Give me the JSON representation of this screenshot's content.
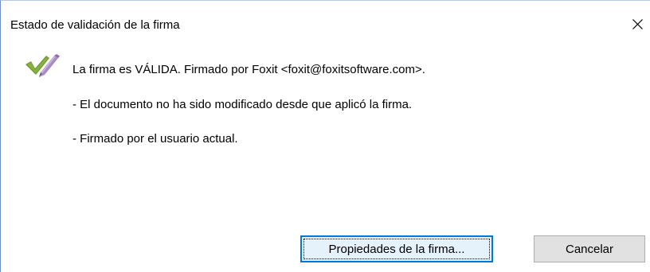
{
  "dialog": {
    "title": "Estado de validación de la firma",
    "close_icon": "close-icon"
  },
  "status": {
    "icon": "signature-valid-icon",
    "main_line": "La firma es VÁLIDA. Firmado por Foxit <foxit@foxitsoftware.com>.",
    "detail_unmodified": "- El documento no ha sido modificado desde que aplicó la firma.",
    "detail_current_user": "- Firmado por el usuario actual."
  },
  "buttons": {
    "properties_label": "Propiedades de la firma...",
    "cancel_label": "Cancelar"
  },
  "colors": {
    "checkmark": "#6f9a2e",
    "pen": "#a88bc4",
    "focus_border": "#0078d7",
    "focused_button_bg": "#e5f1fb",
    "button_bg": "#e1e1e1"
  }
}
